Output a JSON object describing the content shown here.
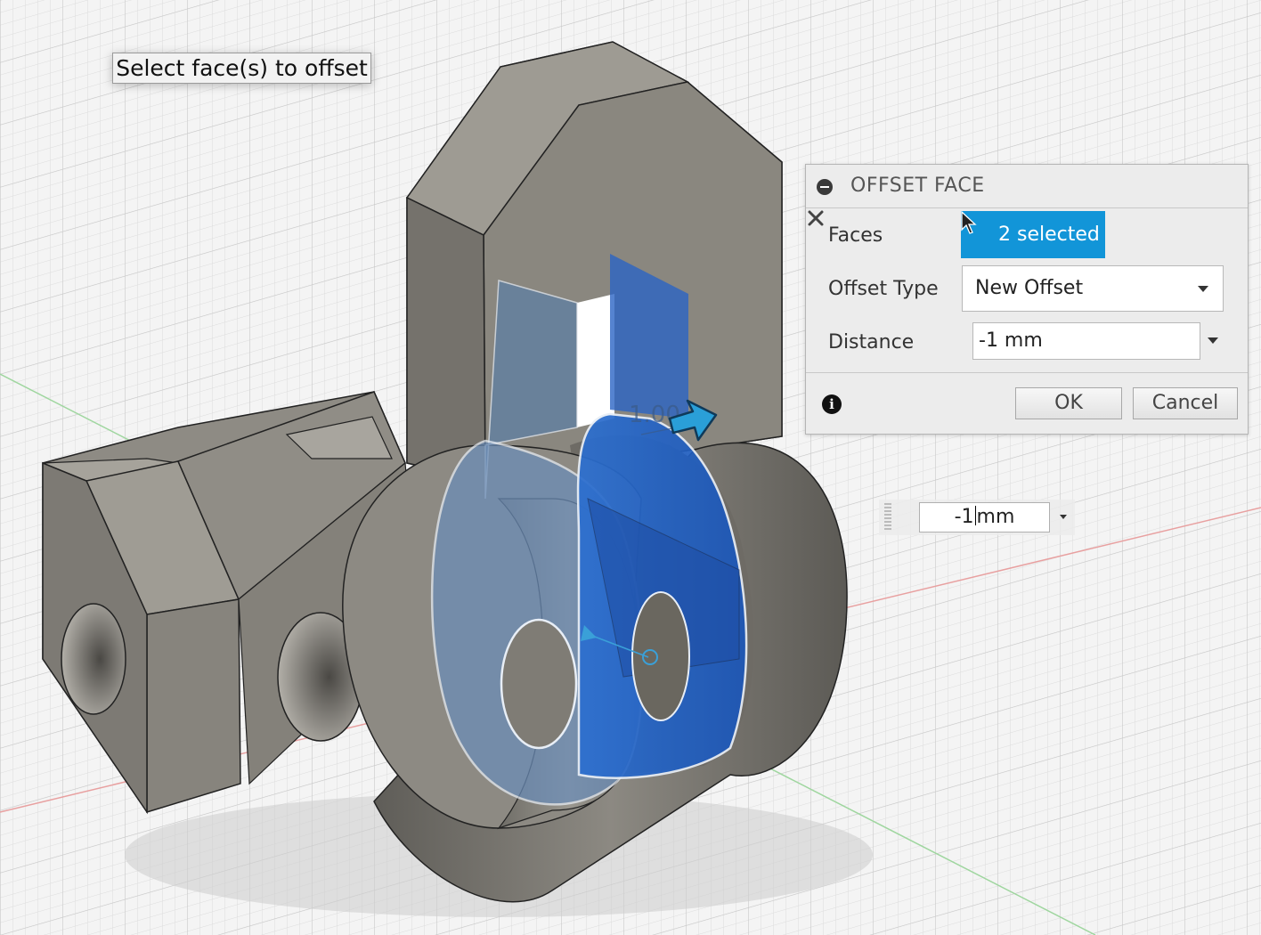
{
  "prompt": {
    "text": "Select face(s) to offset"
  },
  "dialog": {
    "title": "OFFSET FACE",
    "faces": {
      "label": "Faces",
      "selection_text": "2 selected"
    },
    "offset_type": {
      "label": "Offset Type",
      "value": "New Offset"
    },
    "distance": {
      "label": "Distance",
      "value": "-1 mm"
    },
    "ok_label": "OK",
    "cancel_label": "Cancel"
  },
  "canvas": {
    "dimension_label": "1.00",
    "inline_input": {
      "value_before_caret": "-1",
      "value_after_caret": "mm"
    }
  },
  "colors": {
    "selection_blue": "#1d5fbf",
    "button_blue": "#1295d8",
    "model_gray": "#8a877f"
  }
}
